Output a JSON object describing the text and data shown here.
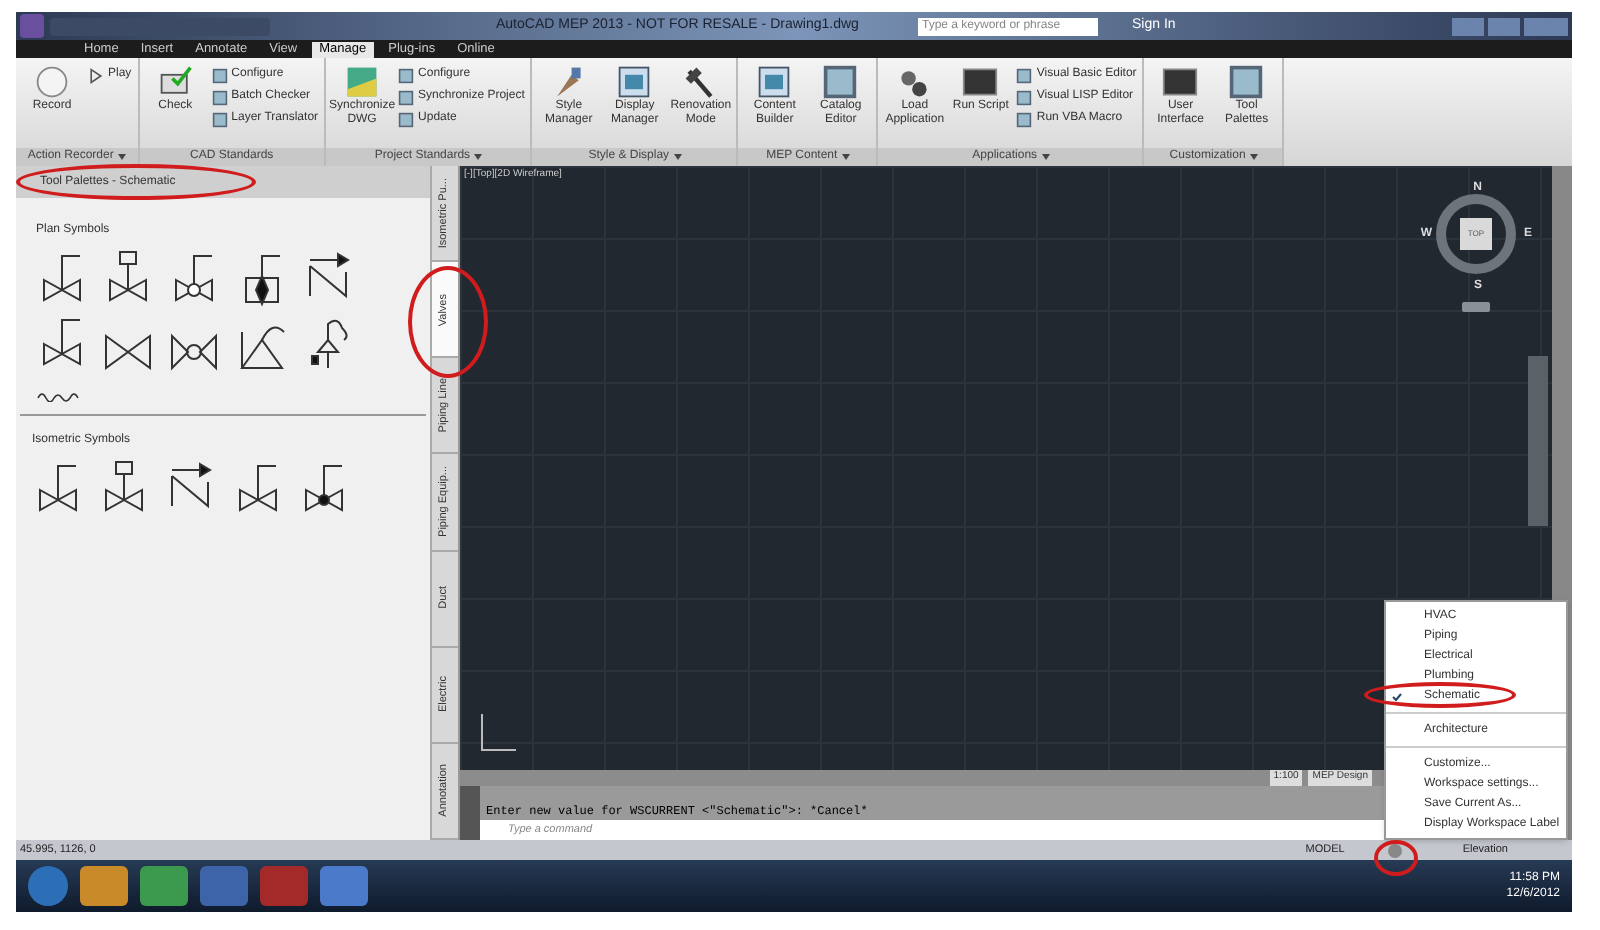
{
  "title_bar": {
    "title": "AutoCAD MEP 2013 - NOT FOR RESALE - Drawing1.dwg",
    "search": {
      "placeholder": "Type a keyword or phrase"
    },
    "sign_in": "Sign In"
  },
  "ribbon_tabs": [
    {
      "label": "Home",
      "selected": false
    },
    {
      "label": "Insert",
      "selected": false
    },
    {
      "label": "Annotate",
      "selected": false
    },
    {
      "label": "View",
      "selected": false
    },
    {
      "label": "Manage",
      "selected": true
    },
    {
      "label": "Plug-ins",
      "selected": false
    },
    {
      "label": "Online",
      "selected": false
    }
  ],
  "ribbon_panels": [
    {
      "label": "Action Recorder",
      "menu": true,
      "items": [
        {
          "kind": "large",
          "label": "Record"
        },
        {
          "kind": "small",
          "label": "Play"
        }
      ]
    },
    {
      "label": "CAD Standards",
      "menu": false,
      "items": [
        {
          "kind": "large",
          "label": "Check"
        },
        {
          "kind": "small",
          "label": "Configure"
        },
        {
          "kind": "small",
          "label": "Batch Checker"
        },
        {
          "kind": "small",
          "label": "Layer Translator"
        }
      ]
    },
    {
      "label": "Project Standards",
      "menu": true,
      "items": [
        {
          "kind": "large",
          "label": "Synchronize DWG"
        },
        {
          "kind": "small",
          "label": "Configure"
        },
        {
          "kind": "small",
          "label": "Synchronize Project"
        },
        {
          "kind": "small",
          "label": "Update"
        }
      ]
    },
    {
      "label": "Style & Display",
      "menu": true,
      "items": [
        {
          "kind": "large",
          "label": "Style Manager"
        },
        {
          "kind": "large",
          "label": "Display Manager"
        },
        {
          "kind": "large",
          "label": "Renovation Mode"
        }
      ]
    },
    {
      "label": "MEP Content",
      "menu": true,
      "items": [
        {
          "kind": "large",
          "label": "Content Builder"
        },
        {
          "kind": "large",
          "label": "Catalog Editor"
        }
      ]
    },
    {
      "label": "Applications",
      "menu": true,
      "items": [
        {
          "kind": "large",
          "label": "Load Application"
        },
        {
          "kind": "large",
          "label": "Run Script"
        },
        {
          "kind": "small",
          "label": "Visual Basic Editor"
        },
        {
          "kind": "small",
          "label": "Visual LISP Editor"
        },
        {
          "kind": "small",
          "label": "Run VBA Macro"
        }
      ]
    },
    {
      "label": "Customization",
      "menu": true,
      "items": [
        {
          "kind": "large",
          "label": "User Interface"
        },
        {
          "kind": "large",
          "label": "Tool Palettes"
        }
      ]
    }
  ],
  "palette": {
    "title": "Tool Palettes - Schematic",
    "sections": [
      {
        "title": "Plan Symbols",
        "symbols": [
          {
            "kind": "gate"
          },
          {
            "kind": "motor"
          },
          {
            "kind": "ball"
          },
          {
            "kind": "solid"
          },
          {
            "kind": "spring"
          },
          {
            "kind": "gate"
          },
          {
            "kind": "plain"
          },
          {
            "kind": "round"
          },
          {
            "kind": "angle"
          },
          {
            "kind": "regulator"
          }
        ]
      },
      {
        "title": "Isometric Symbols",
        "symbols": [
          {
            "kind": "gate"
          },
          {
            "kind": "motor"
          },
          {
            "kind": "spring"
          },
          {
            "kind": "gate"
          },
          {
            "kind": "dot"
          }
        ]
      }
    ],
    "tabs": [
      {
        "label": "Isometric Pu...",
        "selected": false
      },
      {
        "label": "Valves",
        "selected": true
      },
      {
        "label": "Piping Line",
        "selected": false
      },
      {
        "label": "Piping Equip...",
        "selected": false
      },
      {
        "label": "Duct",
        "selected": false
      },
      {
        "label": "Electric",
        "selected": false
      },
      {
        "label": "Annotation",
        "selected": false
      }
    ]
  },
  "viewport": {
    "label": "[-][Top][2D Wireframe]",
    "viewcube": {
      "face": "TOP",
      "north": "N",
      "east": "E",
      "south": "S",
      "west": "W"
    },
    "scale": "1:100",
    "workspace": "MEP Design"
  },
  "command": {
    "history": "Enter new value for WSCURRENT <\"Schematic\">: *Cancel*",
    "placeholder": "Type a command"
  },
  "status_bar": {
    "coordinates": "45.995, 1126, 0",
    "model": "MODEL",
    "elevation": "Elevation"
  },
  "workspace_menu": {
    "groups": [
      [
        {
          "label": "HVAC",
          "checked": false
        },
        {
          "label": "Piping",
          "checked": false
        },
        {
          "label": "Electrical",
          "checked": false
        },
        {
          "label": "Plumbing",
          "checked": false
        },
        {
          "label": "Schematic",
          "checked": true
        }
      ],
      [
        {
          "label": "Architecture",
          "checked": false
        }
      ],
      [
        {
          "label": "Customize...",
          "checked": false
        },
        {
          "label": "Workspace settings...",
          "checked": false
        },
        {
          "label": "Save Current As...",
          "checked": false
        },
        {
          "label": "Display Workspace Label",
          "checked": false
        }
      ]
    ]
  },
  "taskbar": {
    "time": "11:58 PM",
    "date": "12/6/2012"
  }
}
